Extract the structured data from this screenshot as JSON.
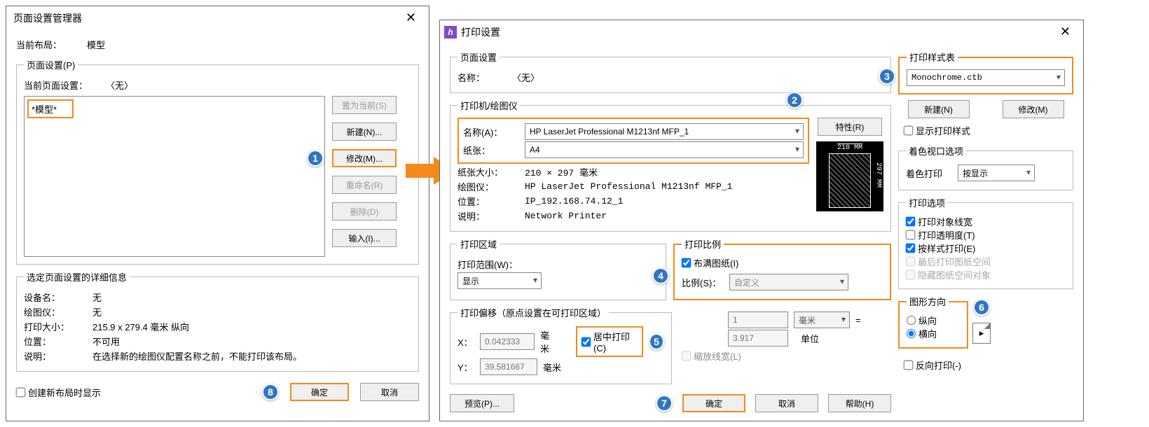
{
  "left": {
    "title": "页面设置管理器",
    "current_layout_label": "当前布局：",
    "current_layout_value": "模型",
    "page_setup_group": "页面设置(P)",
    "current_page_label": "当前页面设置：",
    "current_page_value": "〈无〉",
    "list_item": "*模型*",
    "btn_set_current": "置为当前(S)",
    "btn_new": "新建(N)...",
    "btn_modify": "修改(M)...",
    "btn_rename": "重命名(R)",
    "btn_delete": "删除(D)",
    "btn_import": "输入(I)...",
    "details_group": "选定页面设置的详细信息",
    "device_label": "设备名：",
    "device_value": "无",
    "plotter_label": "绘图仪：",
    "plotter_value": "无",
    "size_label": "打印大小：",
    "size_value": "215.9 x 279.4 毫米 纵向",
    "loc_label": "位置：",
    "loc_value": "不可用",
    "desc_label": "说明：",
    "desc_value": "在选择新的绘图仪配置名称之前，不能打印该布局。",
    "chk_create_layout": "创建新布局时显示",
    "ok": "确定",
    "cancel": "取消"
  },
  "right": {
    "title": "打印设置",
    "page_group": "页面设置",
    "name_label": "名称：",
    "name_value": "〈无〉",
    "printer_group": "打印机/绘图仪",
    "name_a": "名称(A)：",
    "printer_name": "HP LaserJet Professional M1213nf MFP_1",
    "paper_label": "纸张：",
    "paper_value": "A4",
    "paper_size_label": "纸张大小：",
    "paper_size_value": "210 × 297  毫米",
    "plotter_label": "绘图仪：",
    "plotter_value": "HP LaserJet Professional M1213nf MFP_1",
    "loc_label": "位置：",
    "loc_value": "IP_192.168.74.12_1",
    "desc_label": "说明：",
    "desc_value": "Network Printer",
    "btn_props": "特性(R)",
    "preview_top": "210 MM",
    "preview_side": "297 MM",
    "area_group": "打印区域",
    "range_label": "打印范围(W)：",
    "range_value": "显示",
    "offset_group": "打印偏移（原点设置在可打印区域）",
    "x_label": "X：",
    "x_value": "0.042333",
    "unit_mm": "毫米",
    "y_label": "Y：",
    "y_value": "39.581667",
    "center": "居中打印(C)",
    "scale_group": "打印比例",
    "fit": "布满图纸(I)",
    "ratio_label": "比例(S)：",
    "ratio_value": "自定义",
    "num_1": "1",
    "num_unit": "毫米",
    "eq": "=",
    "num_2": "3.917",
    "num_2_unit": "单位",
    "scale_lw": "缩放线宽(L)",
    "style_group": "打印样式表",
    "style_value": "Monochrome.ctb",
    "btn_style_new": "新建(N)",
    "btn_style_mod": "修改(M)",
    "chk_show_style": "显示打印样式",
    "shade_group": "着色视口选项",
    "shade_label": "着色打印",
    "shade_value": "按显示",
    "opt_group": "打印选项",
    "opt1": "打印对象线宽",
    "opt2": "打印透明度(T)",
    "opt3": "按样式打印(E)",
    "opt4": "最后打印图纸空间",
    "opt5": "隐藏图纸空间对象",
    "orient_group": "图形方向",
    "orient_p": "纵向",
    "orient_l": "横向",
    "reverse": "反向打印(-)",
    "preview_btn": "预览(P)...",
    "ok": "确定",
    "cancel": "取消",
    "help": "帮助(H)"
  }
}
